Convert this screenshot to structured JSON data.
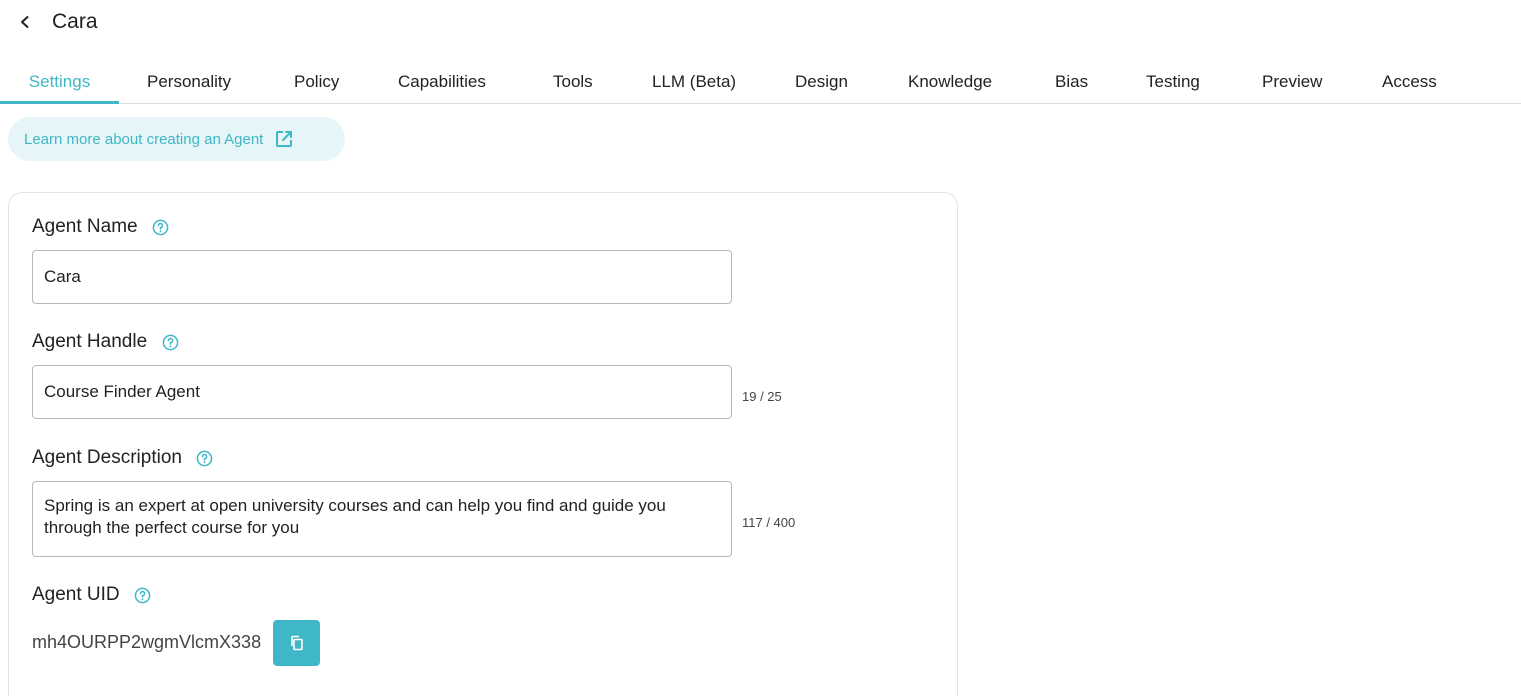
{
  "header": {
    "title": "Cara"
  },
  "tabs": [
    {
      "label": "Settings",
      "active": true
    },
    {
      "label": "Personality"
    },
    {
      "label": "Policy"
    },
    {
      "label": "Capabilities"
    },
    {
      "label": "Tools"
    },
    {
      "label": "LLM (Beta)"
    },
    {
      "label": "Design"
    },
    {
      "label": "Knowledge"
    },
    {
      "label": "Bias"
    },
    {
      "label": "Testing"
    },
    {
      "label": "Preview"
    },
    {
      "label": "Access"
    }
  ],
  "learn_more": {
    "label": "Learn more about creating an Agent",
    "icon": "external-link-icon"
  },
  "form": {
    "name": {
      "label": "Agent Name",
      "value": "Cara"
    },
    "handle": {
      "label": "Agent Handle",
      "value": "Course Finder Agent",
      "counter": "19 / 25"
    },
    "description": {
      "label": "Agent Description",
      "value": "Spring is an expert at open university courses and can help you find and guide you through the perfect course for you",
      "counter": "117 / 400"
    },
    "uid": {
      "label": "Agent UID",
      "value": "mh4OURPP2wgmVlcmX338"
    }
  },
  "colors": {
    "accent": "#3fb7c6",
    "accent_light": "#e6f6f8",
    "border": "#b8b8b8"
  }
}
